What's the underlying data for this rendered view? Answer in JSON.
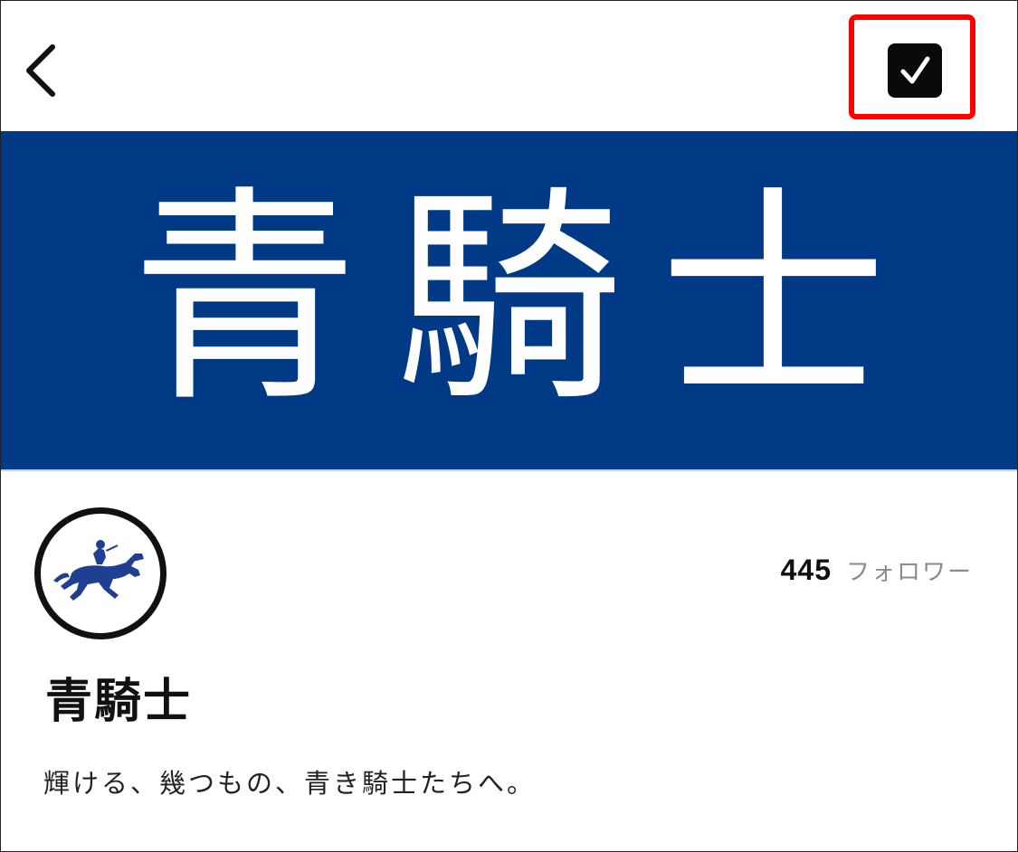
{
  "header": {
    "back_icon": "chevron-left-icon",
    "check_icon": "checkbox-checked-icon",
    "highlight_color": "#ff0000"
  },
  "banner": {
    "title": "青騎士",
    "background_color": "#003a86",
    "text_color": "#ffffff"
  },
  "profile": {
    "avatar_icon": "horse-rider-icon",
    "followers_count": "445",
    "followers_label": "フォロワー",
    "name": "青騎士",
    "bio": "輝ける、幾つもの、青き騎士たちへ。"
  }
}
